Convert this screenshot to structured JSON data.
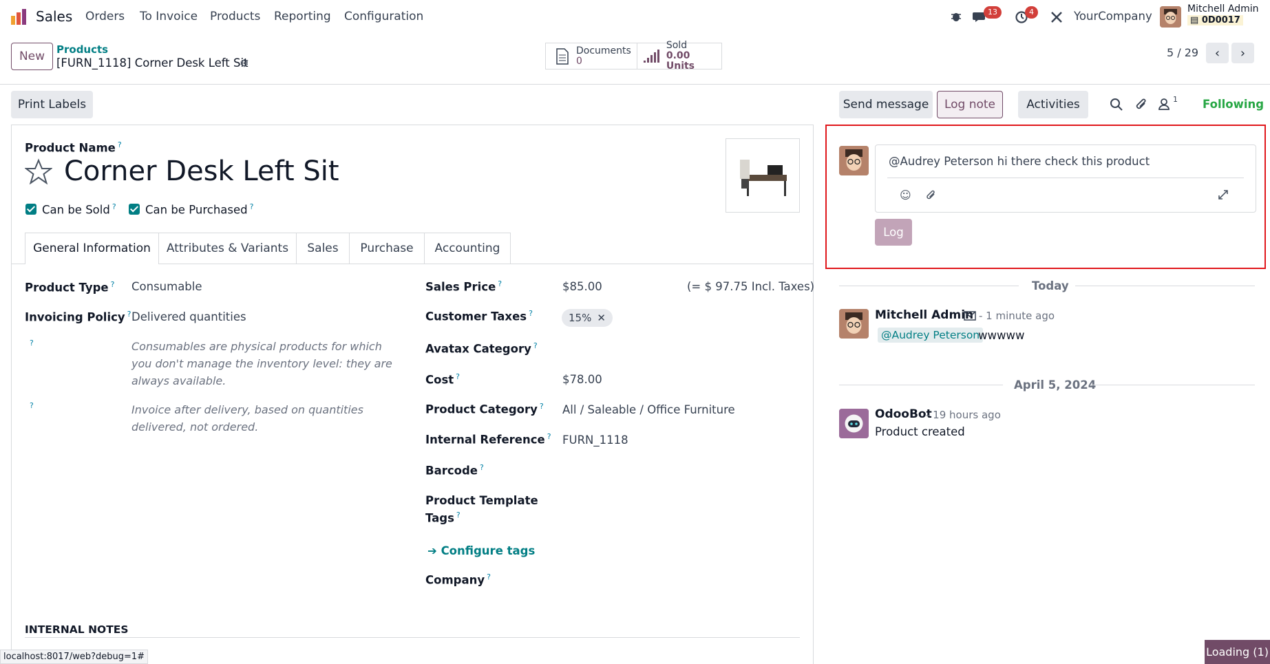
{
  "navbar": {
    "app_name": "Sales",
    "menu": [
      "Orders",
      "To Invoice",
      "Products",
      "Reporting",
      "Configuration"
    ],
    "messages_count": "13",
    "activities_count": "4",
    "company": "YourCompany",
    "user_name": "Mitchell Admin",
    "database": "0D0017"
  },
  "control_panel": {
    "new_label": "New",
    "breadcrumb_parent": "Products",
    "record_title": "[FURN_1118] Corner Desk Left Sit",
    "documents_label": "Documents",
    "documents_value": "0",
    "sold_label": "Sold",
    "sold_value": "0.00 Units",
    "pager": "5 / 29",
    "print_labels": "Print Labels"
  },
  "form": {
    "product_name_label": "Product Name",
    "product_name": "Corner Desk Left Sit",
    "can_be_sold": "Can be Sold",
    "can_be_purchased": "Can be Purchased",
    "tabs": [
      "General Information",
      "Attributes & Variants",
      "Sales",
      "Purchase",
      "Accounting"
    ],
    "product_type_label": "Product Type",
    "product_type": "Consumable",
    "invoicing_policy_label": "Invoicing Policy",
    "invoicing_policy": "Delivered quantities",
    "help_consumable": "Consumables are physical products for which you don't manage the inventory level: they are always available.",
    "help_invoice": "Invoice after delivery, based on quantities delivered, not ordered.",
    "sales_price_label": "Sales Price",
    "sales_price": "$85.00",
    "incl_taxes": "(= $ 97.75 Incl. Taxes)",
    "customer_taxes_label": "Customer Taxes",
    "tax_tag": "15%",
    "avatax_label": "Avatax Category",
    "cost_label": "Cost",
    "cost": "$78.00",
    "category_label": "Product Category",
    "category": "All / Saleable / Office Furniture",
    "internal_ref_label": "Internal Reference",
    "internal_ref": "FURN_1118",
    "barcode_label": "Barcode",
    "tags_label_1": "Product Template",
    "tags_label_2": "Tags",
    "configure_tags": "Configure tags",
    "company_label": "Company",
    "internal_notes": "INTERNAL NOTES"
  },
  "chatter": {
    "send_message": "Send message",
    "log_note": "Log note",
    "activities": "Activities",
    "followers_count": "1",
    "following": "Following",
    "composer_text": "@Audrey Peterson hi there check this product",
    "log_button": "Log",
    "today": "Today",
    "msg1_author": "Mitchell Admin",
    "msg1_time": "- 1 minute ago",
    "msg1_mention": "@Audrey Peterson",
    "msg1_body": "wwwww",
    "date2": "April 5, 2024",
    "msg2_author": "OdooBot",
    "msg2_time": "- 19 hours ago",
    "msg2_body": "Product created"
  },
  "status": {
    "url": "localhost:8017/web?debug=1#",
    "loading": "Loading (1)"
  },
  "colors": {
    "brand": "#714b67",
    "teal": "#017e84",
    "highlight_border": "#e0161b",
    "badge": "#d23f3a"
  }
}
